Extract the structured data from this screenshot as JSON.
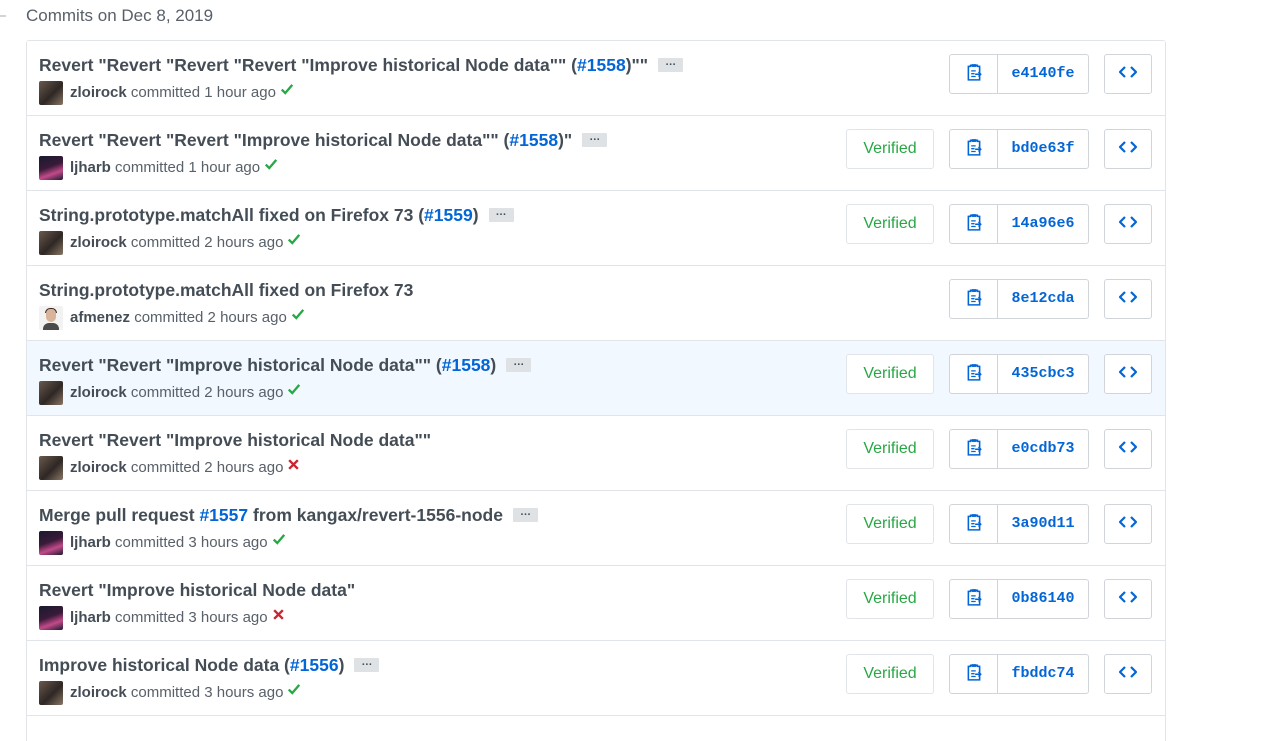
{
  "header": {
    "title": "Commits on Dec 8, 2019"
  },
  "commits": [
    {
      "title_parts": [
        {
          "t": "Revert \"Revert \"Revert \"Revert \"Improve historical Node data\"\" (",
          "issue": false
        },
        {
          "t": "#1558",
          "issue": true
        },
        {
          "t": ")\"\"",
          "issue": false
        }
      ],
      "author": "zloirock",
      "avatar": "zloirock",
      "time": "committed 1 hour ago",
      "status": "success",
      "verified": null,
      "sha": "e4140fe",
      "ellipsis": true,
      "highlight": false
    },
    {
      "title_parts": [
        {
          "t": "Revert \"Revert \"Revert \"Improve historical Node data\"\" (",
          "issue": false
        },
        {
          "t": "#1558",
          "issue": true
        },
        {
          "t": ")\"",
          "issue": false
        }
      ],
      "author": "ljharb",
      "avatar": "ljharb",
      "time": "committed 1 hour ago",
      "status": "success",
      "verified": "Verified",
      "sha": "bd0e63f",
      "ellipsis": true,
      "highlight": false
    },
    {
      "title_parts": [
        {
          "t": "String.prototype.matchAll fixed on Firefox 73 (",
          "issue": false
        },
        {
          "t": "#1559",
          "issue": true
        },
        {
          "t": ")",
          "issue": false
        }
      ],
      "author": "zloirock",
      "avatar": "zloirock",
      "time": "committed 2 hours ago",
      "status": "success",
      "verified": "Verified",
      "sha": "14a96e6",
      "ellipsis": true,
      "highlight": false
    },
    {
      "title_parts": [
        {
          "t": "String.prototype.matchAll fixed on Firefox 73",
          "issue": false
        }
      ],
      "author": "afmenez",
      "avatar": "afmenez",
      "time": "committed 2 hours ago",
      "status": "success",
      "verified": null,
      "sha": "8e12cda",
      "ellipsis": false,
      "highlight": false
    },
    {
      "title_parts": [
        {
          "t": "Revert \"Revert \"Improve historical Node data\"\" (",
          "issue": false
        },
        {
          "t": "#1558",
          "issue": true
        },
        {
          "t": ")",
          "issue": false
        }
      ],
      "author": "zloirock",
      "avatar": "zloirock",
      "time": "committed 2 hours ago",
      "status": "success",
      "verified": "Verified",
      "sha": "435cbc3",
      "ellipsis": true,
      "highlight": true
    },
    {
      "title_parts": [
        {
          "t": "Revert \"Revert \"Improve historical Node data\"\"",
          "issue": false
        }
      ],
      "author": "zloirock",
      "avatar": "zloirock",
      "time": "committed 2 hours ago",
      "status": "failure",
      "verified": "Verified",
      "sha": "e0cdb73",
      "ellipsis": false,
      "highlight": false
    },
    {
      "title_parts": [
        {
          "t": "Merge pull request ",
          "issue": false
        },
        {
          "t": "#1557",
          "issue": true
        },
        {
          "t": " from kangax/revert-1556-node",
          "issue": false
        }
      ],
      "author": "ljharb",
      "avatar": "ljharb",
      "time": "committed 3 hours ago",
      "status": "success",
      "verified": "Verified",
      "sha": "3a90d11",
      "ellipsis": true,
      "highlight": false
    },
    {
      "title_parts": [
        {
          "t": "Revert \"Improve historical Node data\"",
          "issue": false
        }
      ],
      "author": "ljharb",
      "avatar": "ljharb",
      "time": "committed 3 hours ago",
      "status": "failure",
      "verified": "Verified",
      "sha": "0b86140",
      "ellipsis": false,
      "highlight": false
    },
    {
      "title_parts": [
        {
          "t": "Improve historical Node data (",
          "issue": false
        },
        {
          "t": "#1556",
          "issue": true
        },
        {
          "t": ")",
          "issue": false
        }
      ],
      "author": "zloirock",
      "avatar": "zloirock",
      "time": "committed 3 hours ago",
      "status": "success",
      "verified": "Verified",
      "sha": "fbddc74",
      "ellipsis": true,
      "highlight": false
    }
  ],
  "ellipsis_label": "…",
  "colors": {
    "link": "#0366d6",
    "success": "#28a745",
    "failure": "#cb2431",
    "verified": "#28a745"
  },
  "icons": {
    "copy": "clippy-icon",
    "browse": "code-icon",
    "success": "check-icon",
    "failure": "x-icon"
  }
}
